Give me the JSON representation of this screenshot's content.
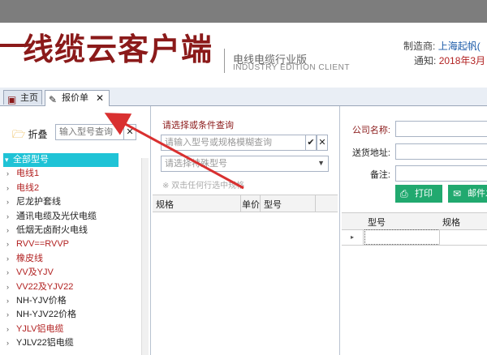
{
  "header": {
    "logo_text": "线缆云客户端",
    "subtitle_cn": "电线电缆行业版",
    "subtitle_en": "INDUSTRY EDITION CLIENT",
    "manufacturer_label": "制造商:",
    "manufacturer_value": "上海起帆(",
    "notice_label": "通知:",
    "notice_value": "2018年3月"
  },
  "tabs": [
    {
      "label": "主页",
      "icon": "home-icon"
    },
    {
      "label": "报价单",
      "icon": "pencil-icon",
      "close": "✕"
    }
  ],
  "left": {
    "fold_label": "折叠",
    "search_placeholder": "输入型号查询",
    "search_clear": "✕",
    "tree": [
      {
        "label": "全部型号",
        "root": true
      },
      {
        "label": "电线1",
        "red": true
      },
      {
        "label": "电线2",
        "red": true
      },
      {
        "label": "尼龙护套线",
        "red": false
      },
      {
        "label": "通讯电缆及光伏电缆",
        "red": false
      },
      {
        "label": "低烟无卤耐火电线",
        "red": false
      },
      {
        "label": "RVV==RVVP",
        "red": true
      },
      {
        "label": "橡皮线",
        "red": true
      },
      {
        "label": "VV及YJV",
        "red": true
      },
      {
        "label": "VV22及YJV22",
        "red": true
      },
      {
        "label": "NH-YJV价格",
        "red": false
      },
      {
        "label": "NH-YJV22价格",
        "red": false
      },
      {
        "label": "YJLV铝电缆",
        "red": true
      },
      {
        "label": "YJLV22铝电缆",
        "red": false
      }
    ]
  },
  "middle": {
    "query_label": "请选择或条件查询",
    "query_placeholder": "请输入型号或规格模糊查询",
    "confirm": "✔",
    "clear": "✕",
    "special_placeholder": "请选择特殊型号",
    "hint": "※ 双击任何行选中规格",
    "columns": [
      "规格",
      "单价",
      "型号"
    ]
  },
  "right": {
    "company_label": "公司名称:",
    "address_label": "送货地址:",
    "remark_label": "备注:",
    "print_label": "打印",
    "email_label": "邮件发",
    "columns": [
      "型号",
      "规格"
    ]
  },
  "colors": {
    "brand": "#8b1a1a",
    "accent_teal": "#1fc3d6",
    "button_green": "#21a96f",
    "annotation_arrow": "#d93030"
  }
}
